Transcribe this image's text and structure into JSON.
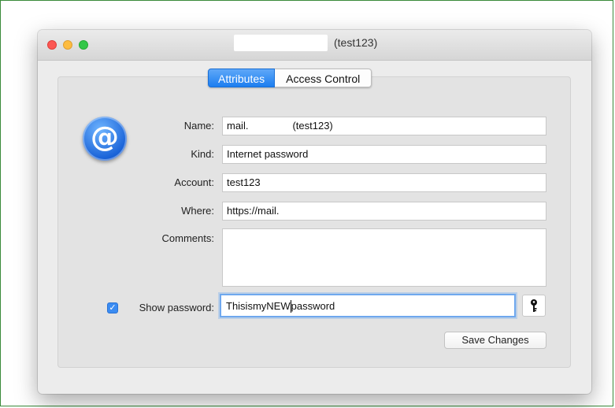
{
  "window": {
    "title": "(test123)"
  },
  "tabs": [
    {
      "label": "Attributes",
      "active": true
    },
    {
      "label": "Access Control",
      "active": false
    }
  ],
  "form": {
    "name_label": "Name:",
    "name_value": "mail.",
    "name_value_suffix": "(test123)",
    "kind_label": "Kind:",
    "kind_value": "Internet password",
    "account_label": "Account:",
    "account_value": "test123",
    "where_label": "Where:",
    "where_value": "https://mail.",
    "comments_label": "Comments:",
    "comments_value": "",
    "show_password_label": "Show password:",
    "show_password_checked": true,
    "password_before_cursor": "ThisismyNEW",
    "password_after_cursor": "password"
  },
  "buttons": {
    "save_label": "Save Changes"
  },
  "icons": {
    "item_icon": "at-sign-icon",
    "key_icon": "key-icon"
  },
  "colors": {
    "accent": "#1c7ef0",
    "close": "#fc5753",
    "minimize": "#fdbc40",
    "maximize": "#33c748"
  }
}
